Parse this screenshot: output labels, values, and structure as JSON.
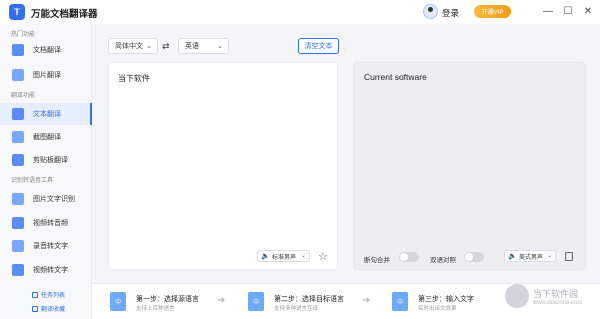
{
  "app": {
    "logo_glyph": "T",
    "title": "万能文档翻译器"
  },
  "header": {
    "login": "登录",
    "vip": "开通VIP",
    "minimize": "—",
    "maximize": "☐",
    "close": "✕"
  },
  "sidebar": {
    "sections": {
      "hot": "热门功能",
      "translate": "翻译功能",
      "recognize": "识别转语音工具"
    },
    "items": [
      {
        "label": "文档翻译"
      },
      {
        "label": "图片翻译"
      },
      {
        "label": "文本翻译"
      },
      {
        "label": "截图翻译"
      },
      {
        "label": "剪贴板翻译"
      },
      {
        "label": "图片文字识别"
      },
      {
        "label": "视频转音频"
      },
      {
        "label": "录音转文字"
      },
      {
        "label": "视频转文字"
      }
    ],
    "footer": {
      "tasks": "任务列表",
      "favorites": "翻译收藏"
    }
  },
  "toolbar": {
    "source_lang": "简体中文",
    "swap_glyph": "⇄",
    "target_lang": "英语",
    "clear": "清空文本"
  },
  "editor": {
    "source_text": "当下软件",
    "target_text": "Current software",
    "source_voice": "标准男声",
    "target_voice": "美式男声",
    "sentence_merge": "断句合并",
    "bilingual": "双语对照"
  },
  "steps": [
    {
      "icon_text": "中",
      "title": "第一步：选择源语言",
      "sub": "支持上百种语言"
    },
    {
      "icon_text": "中",
      "title": "第二步：选择目标语言",
      "sub": "支持多种语言互译"
    },
    {
      "icon_text": "中",
      "title": "第三步：输入文字",
      "sub": "实时出译文效果"
    }
  ],
  "watermark": {
    "name": "当下软件园",
    "url": "www.downxia.com"
  },
  "colors": {
    "accent": "#2f6ff0",
    "vip": "#f39c12"
  }
}
